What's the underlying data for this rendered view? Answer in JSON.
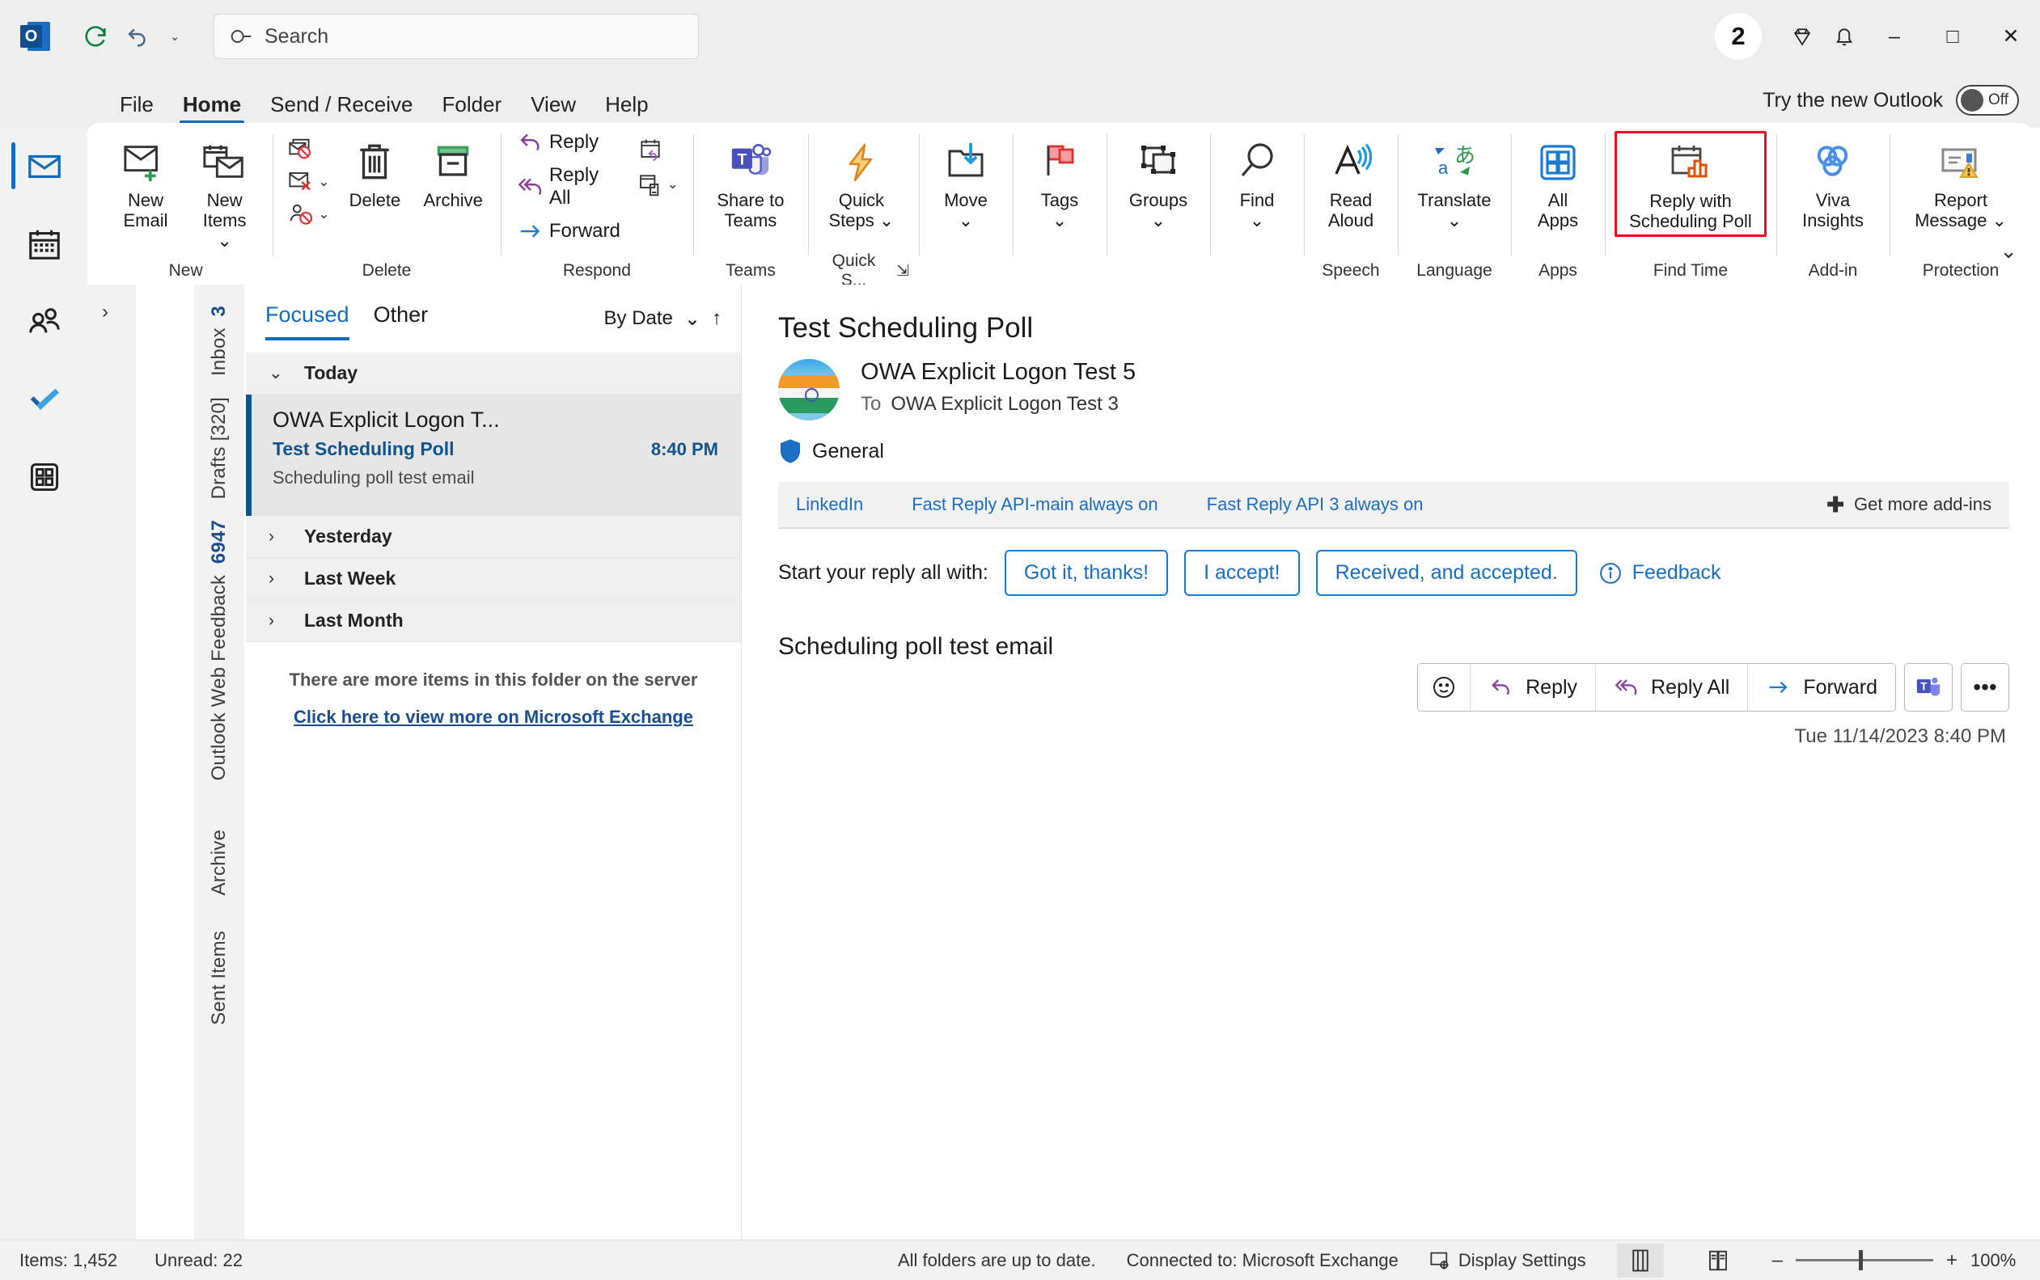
{
  "titlebar": {
    "app_logo": "outlook-logo",
    "refresh_tooltip": "Send/Receive All Folders",
    "undo_tooltip": "Undo",
    "qat_chevron": "⌄",
    "search": {
      "placeholder": "Search",
      "value": ""
    },
    "account_badge": "2",
    "diamond_label": "Microsoft 365 Insider",
    "bell_label": "Notifications",
    "minimize": "–",
    "maximize": "□",
    "close": "✕"
  },
  "menu": {
    "items": [
      {
        "label": "File",
        "active": false
      },
      {
        "label": "Home",
        "active": true
      },
      {
        "label": "Send / Receive",
        "active": false
      },
      {
        "label": "Folder",
        "active": false
      },
      {
        "label": "View",
        "active": false
      },
      {
        "label": "Help",
        "active": false
      }
    ],
    "try_new_outlook": {
      "label": "Try the new Outlook",
      "state": "Off"
    }
  },
  "app_rail": [
    {
      "name": "mail",
      "selected": true
    },
    {
      "name": "calendar",
      "selected": false
    },
    {
      "name": "people",
      "selected": false
    },
    {
      "name": "todo",
      "selected": false
    },
    {
      "name": "more-apps",
      "selected": false
    }
  ],
  "ribbon": {
    "groups": [
      {
        "label": "New",
        "buttons": [
          {
            "label": "New\nEmail",
            "icon": "new-email-icon"
          },
          {
            "label": "New\nItems ⌄",
            "icon": "new-items-icon"
          }
        ]
      },
      {
        "label": "Delete",
        "small_buttons": [
          {
            "label": "",
            "icon": "ignore-icon"
          },
          {
            "label": "",
            "icon": "junk-icon"
          },
          {
            "label": "",
            "icon": "block-sender-icon"
          }
        ],
        "buttons": [
          {
            "label": "Delete",
            "icon": "delete-icon"
          },
          {
            "label": "Archive",
            "icon": "archive-icon"
          }
        ]
      },
      {
        "label": "Respond",
        "text_buttons": [
          {
            "label": "Reply",
            "icon": "reply-icon"
          },
          {
            "label": "Reply All",
            "icon": "reply-all-icon"
          },
          {
            "label": "Forward",
            "icon": "forward-icon"
          }
        ],
        "small_buttons": [
          {
            "label": "",
            "icon": "meeting-icon"
          },
          {
            "label": "",
            "icon": "more-respond-icon"
          }
        ]
      },
      {
        "label": "Teams",
        "buttons": [
          {
            "label": "Share to\nTeams",
            "icon": "teams-icon"
          }
        ]
      },
      {
        "label": "Quick S...",
        "has_dialog_launcher": true,
        "buttons": [
          {
            "label": "Quick\nSteps ⌄",
            "icon": "quick-steps-icon"
          }
        ]
      },
      {
        "label": "",
        "buttons": [
          {
            "label": "Move\n⌄",
            "icon": "move-icon"
          }
        ]
      },
      {
        "label": "",
        "buttons": [
          {
            "label": "Tags\n⌄",
            "icon": "tags-icon"
          }
        ]
      },
      {
        "label": "",
        "buttons": [
          {
            "label": "Groups\n⌄",
            "icon": "groups-icon"
          }
        ]
      },
      {
        "label": "",
        "buttons": [
          {
            "label": "Find\n⌄",
            "icon": "find-icon"
          }
        ]
      },
      {
        "label": "Speech",
        "buttons": [
          {
            "label": "Read\nAloud",
            "icon": "read-aloud-icon"
          }
        ]
      },
      {
        "label": "Language",
        "buttons": [
          {
            "label": "Translate\n⌄",
            "icon": "translate-icon"
          }
        ]
      },
      {
        "label": "Apps",
        "buttons": [
          {
            "label": "All\nApps",
            "icon": "all-apps-icon"
          }
        ]
      },
      {
        "label": "Find Time",
        "highlighted": true,
        "buttons": [
          {
            "label": "Reply with\nScheduling Poll",
            "icon": "scheduling-poll-icon"
          }
        ]
      },
      {
        "label": "Add-in",
        "buttons": [
          {
            "label": "Viva\nInsights",
            "icon": "viva-insights-icon"
          }
        ]
      },
      {
        "label": "Protection",
        "buttons": [
          {
            "label": "Report\nMessage ⌄",
            "icon": "report-message-icon"
          }
        ]
      }
    ],
    "collapse_chevron": "⌄"
  },
  "folder_pane": {
    "expand_chevron": "›",
    "collapsed_folders": [
      {
        "label": "Inbox",
        "count": "3",
        "bold_count": true
      },
      {
        "label": "Drafts [320]",
        "count": "",
        "bold_count": false
      },
      {
        "label": "Outlook Web Feedback",
        "count": "6947",
        "bold_count": true
      },
      {
        "label": "Archive",
        "count": "",
        "bold_count": false
      },
      {
        "label": "Sent Items",
        "count": "",
        "bold_count": false
      }
    ]
  },
  "mail_list": {
    "pivots": [
      {
        "label": "Focused",
        "active": true
      },
      {
        "label": "Other",
        "active": false
      }
    ],
    "sort": {
      "label": "By Date",
      "chevron": "⌄",
      "direction_icon": "↑"
    },
    "groups": [
      {
        "label": "Today",
        "expanded": true,
        "chevron": "⌄"
      },
      {
        "label": "Yesterday",
        "expanded": false,
        "chevron": "›"
      },
      {
        "label": "Last Week",
        "expanded": false,
        "chevron": "›"
      },
      {
        "label": "Last Month",
        "expanded": false,
        "chevron": "›"
      }
    ],
    "items": [
      {
        "from": "OWA Explicit Logon T...",
        "subject": "Test Scheduling Poll",
        "time": "8:40 PM",
        "preview": "Scheduling poll test email",
        "selected": true
      }
    ],
    "more_items_text": "There are more items in this folder on the server",
    "more_items_link": "Click here to view more on Microsoft Exchange"
  },
  "reading_pane": {
    "subject": "Test Scheduling Poll",
    "from": "OWA Explicit Logon Test 5",
    "to_label": "To",
    "to": "OWA Explicit Logon Test 3",
    "sensitivity": "General",
    "date": "Tue 11/14/2023 8:40 PM",
    "actions": [
      {
        "label": "",
        "icon": "emoji-reaction-icon"
      },
      {
        "label": "Reply",
        "icon": "reply-icon"
      },
      {
        "label": "Reply All",
        "icon": "reply-all-icon"
      },
      {
        "label": "Forward",
        "icon": "forward-icon"
      }
    ],
    "teams_button": "teams-icon",
    "more_button": "•••",
    "addins": [
      {
        "label": "LinkedIn"
      },
      {
        "label": "Fast Reply API-main always on"
      },
      {
        "label": "Fast Reply API 3 always on"
      }
    ],
    "get_more_addins": "Get more add-ins",
    "quick_reply": {
      "label": "Start your reply all with:",
      "suggestions": [
        "Got it, thanks!",
        "I accept!",
        "Received, and accepted."
      ],
      "feedback": "Feedback"
    },
    "body": "Scheduling poll test email"
  },
  "status_bar": {
    "items_count": "Items: 1,452",
    "unread_count": "Unread: 22",
    "sync_status": "All folders are up to date.",
    "connection": "Connected to: Microsoft Exchange",
    "display_settings": "Display Settings",
    "view_normal": "normal-view-icon",
    "view_reading": "reading-view-icon",
    "zoom_minus": "–",
    "zoom_plus": "+",
    "zoom_level": "100%"
  },
  "colors": {
    "accent": "#0f6cbd",
    "link": "#1b6ec2",
    "highlight_border": "#e81123",
    "selected_bar": "#0f548c",
    "titlebar_bg": "#eeeeee"
  }
}
